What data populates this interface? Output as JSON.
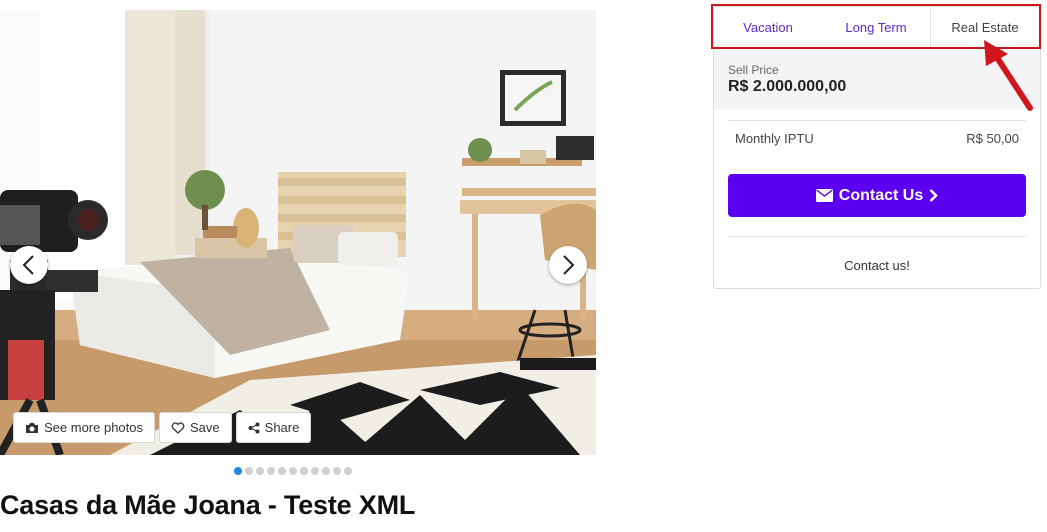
{
  "gallery": {
    "prev_icon": "chevron-left-icon",
    "next_icon": "chevron-right-icon",
    "actions": {
      "see_more_photos": "See more photos",
      "save": "Save",
      "share": "Share"
    },
    "dots_count": 11,
    "active_dot": 1
  },
  "listing": {
    "title": "Casas da Mãe Joana - Teste XML"
  },
  "panel": {
    "tabs": [
      {
        "label": "Vacation"
      },
      {
        "label": "Long Term"
      },
      {
        "label": "Real Estate"
      }
    ],
    "active_tab": "Real Estate",
    "price_label": "Sell Price",
    "price_value": "R$ 2.000.000,00",
    "iptu_label": "Monthly IPTU",
    "iptu_value": "R$ 50,00",
    "contact_button": "Contact Us",
    "contact_link": "Contact us!"
  },
  "colors": {
    "accent": "#5d00f1",
    "tab_text": "#5b2bc9",
    "highlight": "#d0171e",
    "active_dot": "#1e88e5"
  }
}
